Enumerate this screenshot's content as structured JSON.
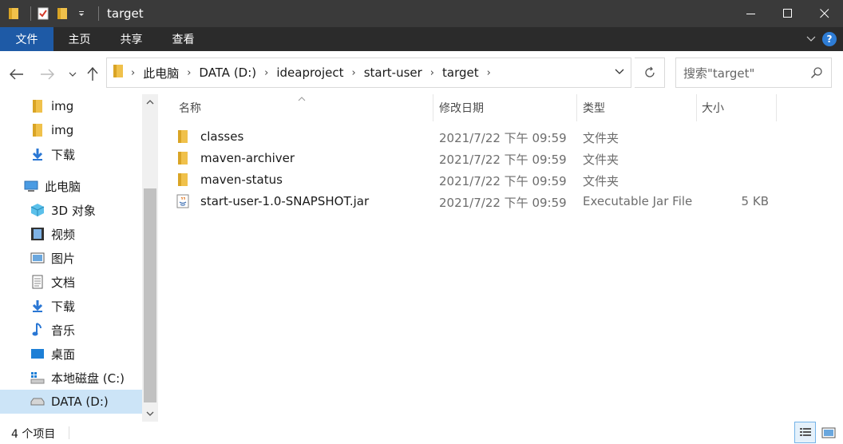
{
  "window": {
    "title": "target",
    "minimize": "—",
    "maximize": "□",
    "close": "✕"
  },
  "ribbon": {
    "tabs": [
      {
        "label": "文件",
        "active": true
      },
      {
        "label": "主页"
      },
      {
        "label": "共享"
      },
      {
        "label": "查看"
      }
    ],
    "expand_glyph": "⌄",
    "help_glyph": "?"
  },
  "address": {
    "crumbs": [
      "此电脑",
      "DATA (D:)",
      "ideaproject",
      "start-user",
      "target"
    ],
    "search_placeholder": "搜索\"target\""
  },
  "nav_pane": {
    "items": [
      {
        "label": "img",
        "icon": "folder-icon"
      },
      {
        "label": "img",
        "icon": "folder-icon"
      },
      {
        "label": "下载",
        "icon": "download-icon"
      },
      {
        "label": "此电脑",
        "icon": "pc-icon"
      },
      {
        "label": "3D 对象",
        "icon": "3d-objects-icon"
      },
      {
        "label": "视频",
        "icon": "video-icon"
      },
      {
        "label": "图片",
        "icon": "pictures-icon"
      },
      {
        "label": "文档",
        "icon": "documents-icon"
      },
      {
        "label": "下载",
        "icon": "download-icon"
      },
      {
        "label": "音乐",
        "icon": "music-icon"
      },
      {
        "label": "桌面",
        "icon": "desktop-icon"
      },
      {
        "label": "本地磁盘 (C:)",
        "icon": "windows-drive-icon"
      },
      {
        "label": "DATA (D:)",
        "icon": "drive-icon",
        "selected": true
      }
    ]
  },
  "columns": {
    "name": "名称",
    "date": "修改日期",
    "type": "类型",
    "size": "大小"
  },
  "files": [
    {
      "name": "classes",
      "date": "2021/7/22 下午 09:59",
      "type": "文件夹",
      "size": "",
      "icon": "folder-icon"
    },
    {
      "name": "maven-archiver",
      "date": "2021/7/22 下午 09:59",
      "type": "文件夹",
      "size": "",
      "icon": "folder-icon"
    },
    {
      "name": "maven-status",
      "date": "2021/7/22 下午 09:59",
      "type": "文件夹",
      "size": "",
      "icon": "folder-icon"
    },
    {
      "name": "start-user-1.0-SNAPSHOT.jar",
      "date": "2021/7/22 下午 09:59",
      "type": "Executable Jar File",
      "size": "5 KB",
      "icon": "jar-file-icon"
    }
  ],
  "status": {
    "item_count": "4 个项目"
  },
  "colors": {
    "titlebar": "#3a3a3a",
    "ribbon": "#2b2b2b",
    "file_tab": "#1e5aa6",
    "folder": "#f0c14b",
    "selection": "#cce4f7"
  }
}
